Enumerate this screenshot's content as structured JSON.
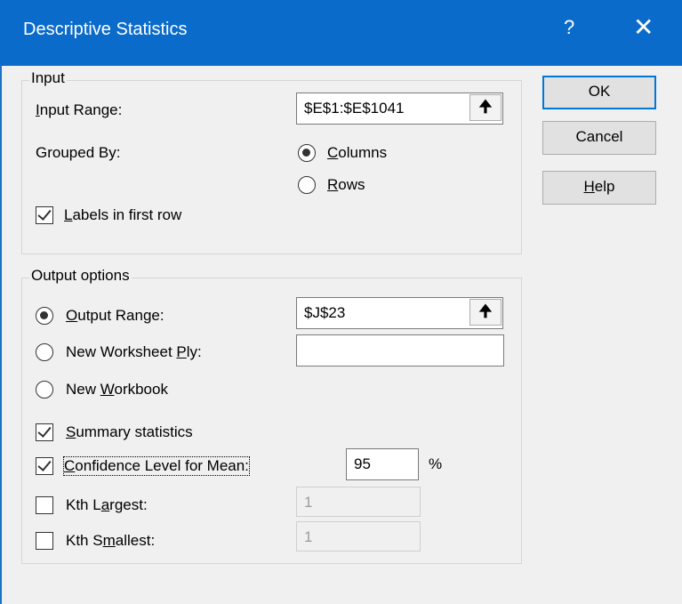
{
  "window": {
    "title": "Descriptive Statistics",
    "help_glyph": "?",
    "close_glyph": "✕"
  },
  "input_group": {
    "label": "Input",
    "input_range_label": {
      "u": "I",
      "rest": "nput Range:"
    },
    "input_range_value": "$E$1:$E$1041",
    "grouped_by_label": "Grouped By:",
    "columns_label": {
      "u": "C",
      "rest": "olumns"
    },
    "rows_label": {
      "u": "R",
      "rest": "ows"
    },
    "grouped_by_selected": "Columns",
    "labels_first_row": {
      "u": "L",
      "rest": "abels in first row"
    },
    "labels_first_row_checked": true
  },
  "output_group": {
    "label": "Output options",
    "output_range": {
      "u": "O",
      "rest": "utput Range:"
    },
    "output_range_value": "$J$23",
    "new_worksheet": {
      "pre": "New Worksheet ",
      "u": "P",
      "rest": "ly:"
    },
    "new_worksheet_value": "",
    "new_workbook": {
      "pre": "New ",
      "u": "W",
      "rest": "orkbook"
    },
    "selected": "Output Range",
    "summary_statistics": {
      "u": "S",
      "rest": "ummary statistics"
    },
    "summary_checked": true,
    "confidence_level": {
      "u": "C",
      "rest": "onfidence Level for Mean:"
    },
    "confidence_checked": true,
    "confidence_value": "95",
    "percent": "%",
    "kth_largest": {
      "pre": "Kth L",
      "u": "a",
      "rest": "rgest:"
    },
    "kth_largest_checked": false,
    "kth_largest_value": "1",
    "kth_smallest": {
      "pre": "Kth S",
      "u": "m",
      "rest": "allest:"
    },
    "kth_smallest_checked": false,
    "kth_smallest_value": "1",
    "range_button_glyph": "🠉"
  },
  "buttons": {
    "ok": "OK",
    "cancel": "Cancel",
    "help": {
      "u": "H",
      "rest": "elp"
    }
  }
}
